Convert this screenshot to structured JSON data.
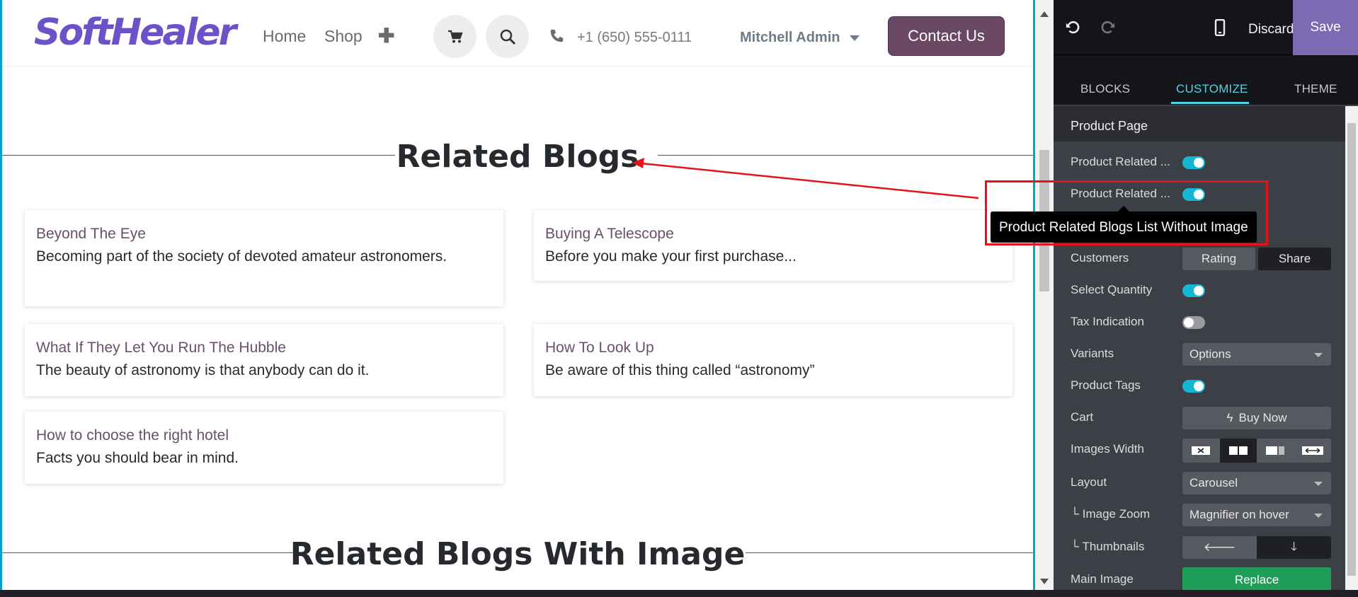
{
  "header": {
    "logo": "SoftHealer",
    "nav": [
      "Home",
      "Shop"
    ],
    "plus": "✚",
    "phone": "+1 (650) 555-0111",
    "user": "Mitchell Admin",
    "contact": "Contact Us"
  },
  "main": {
    "section1_title": "Related Blogs",
    "cards": [
      {
        "title": "Beyond The Eye",
        "text": "Becoming part of the society of devoted amateur astronomers."
      },
      {
        "title": "Buying A Telescope",
        "text": "Before you make your first purchase..."
      },
      {
        "title": "What If They Let You Run The Hubble",
        "text": "The beauty of astronomy is that anybody can do it."
      },
      {
        "title": "How To Look Up",
        "text": "Be aware of this thing called “astronomy”"
      },
      {
        "title": "How to choose the right hotel",
        "text": "Facts you should bear in mind."
      }
    ],
    "section2_title": "Related Blogs With Image"
  },
  "editor": {
    "discard": "Discard",
    "save": "Save",
    "tabs": [
      "BLOCKS",
      "CUSTOMIZE",
      "THEME"
    ],
    "section": "Product Page",
    "options": {
      "related1": "Product Related ...",
      "related2": "Product Related ...",
      "customers": "Customers",
      "rating": "Rating",
      "share": "Share",
      "select_quantity": "Select Quantity",
      "tax_indication": "Tax Indication",
      "variants": "Variants",
      "variants_value": "Options",
      "product_tags": "Product Tags",
      "cart": "Cart",
      "cart_value": "Buy Now",
      "images_width": "Images Width",
      "layout": "Layout",
      "layout_value": "Carousel",
      "image_zoom": "└ Image Zoom",
      "image_zoom_value": "Magnifier on hover",
      "thumbnails": "└ Thumbnails",
      "main_image": "Main Image",
      "replace": "Replace"
    }
  },
  "tooltip": "Product Related Blogs List Without Image",
  "colors": {
    "accent": "#15b6d2",
    "brand": "#6c52c9",
    "contact": "#6a4762",
    "save": "#7c6bb3",
    "highlight": "#e4121a"
  }
}
